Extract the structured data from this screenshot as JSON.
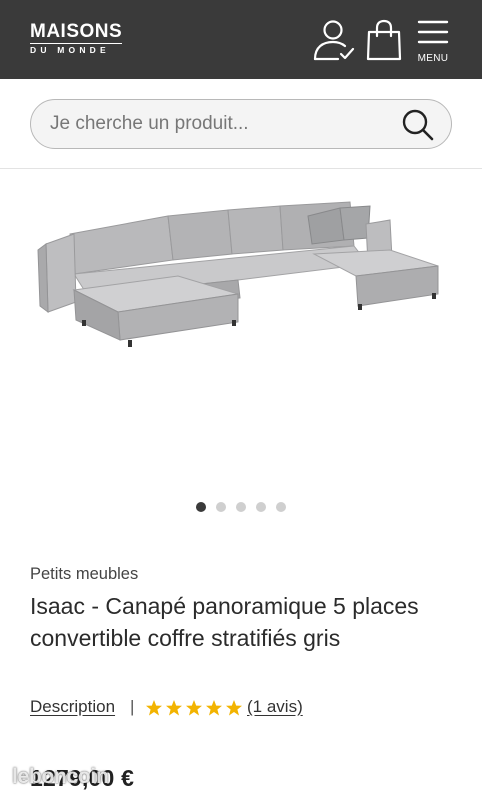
{
  "header": {
    "logo_main": "MAISONS",
    "logo_sub": "DU MONDE",
    "menu_label": "MENU",
    "icons": [
      "account-icon",
      "shopping-bag-icon",
      "menu-icon"
    ],
    "background": "#3a3a3a"
  },
  "search": {
    "placeholder": "Je cherche un produit..."
  },
  "gallery": {
    "image": "sofa-image",
    "slide_count": 5,
    "active_slide": 1
  },
  "product": {
    "category": "Petits meubles",
    "title": "Isaac - Canapé panoramique 5 places convertible coffre stratifiés gris",
    "description_label": "Description",
    "separator": "|",
    "rating": 5,
    "rating_max": 5,
    "star_color": "#f2b300",
    "reviews_label": "(1 avis)",
    "price": "1279,00 €"
  },
  "watermark": {
    "text": "leboncoin"
  }
}
